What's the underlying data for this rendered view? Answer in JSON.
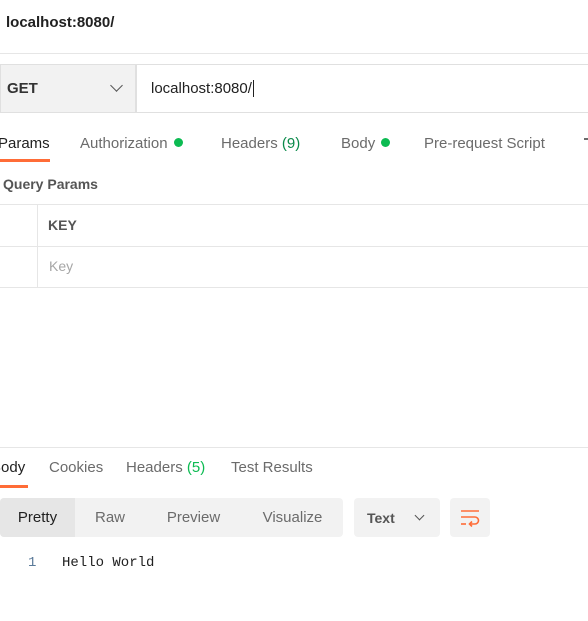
{
  "window": {
    "title": "localhost:8080/"
  },
  "request": {
    "method": "GET",
    "url": "localhost:8080/"
  },
  "request_tabs": [
    {
      "label": "Params",
      "active": true
    },
    {
      "label": "Authorization",
      "dot": true
    },
    {
      "label": "Headers",
      "count": "(9)"
    },
    {
      "label": "Body",
      "dot": true
    },
    {
      "label": "Pre-request Script"
    }
  ],
  "params": {
    "section_title": "Query Params",
    "key_header": "KEY",
    "key_placeholder": "Key"
  },
  "response_tabs": [
    {
      "label": "Body",
      "active": true
    },
    {
      "label": "Cookies"
    },
    {
      "label": "Headers",
      "count": "(5)"
    },
    {
      "label": "Test Results"
    }
  ],
  "response_toolbar": {
    "views": [
      "Pretty",
      "Raw",
      "Preview",
      "Visualize"
    ],
    "active_view": "Pretty",
    "format": "Text",
    "wrap_icon": "wrap-lines-icon"
  },
  "response_body": {
    "lines": [
      {
        "number": "1",
        "text": "Hello World"
      }
    ]
  },
  "colors": {
    "accent": "#ff6c37",
    "status_dot": "#0cbb52"
  }
}
